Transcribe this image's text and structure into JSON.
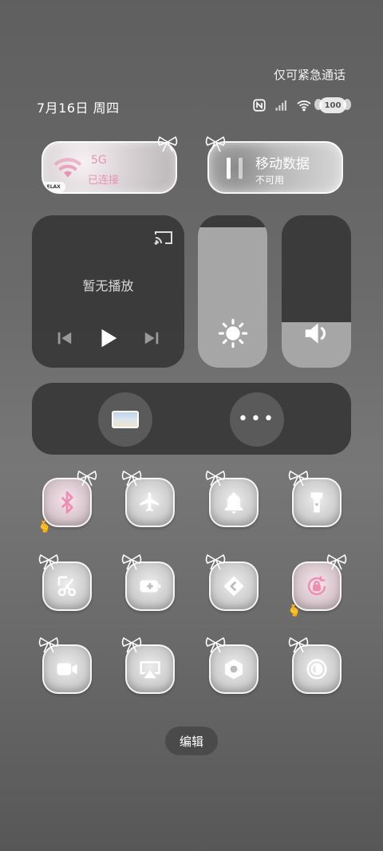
{
  "status_bar": {
    "emergency_text": "仅可紧急通话",
    "date_text": "7月16日 周四",
    "battery_level": "100",
    "icons": [
      "nfc-icon",
      "signal-icon",
      "wifi-status-icon",
      "battery-icon"
    ]
  },
  "wifi_tile": {
    "ssid": "5G",
    "status": "已连接",
    "tag": "RELAX"
  },
  "data_tile": {
    "title": "移动数据",
    "status": "不可用"
  },
  "media": {
    "status": "暂无播放"
  },
  "brightness": {
    "level": 0.92
  },
  "volume": {
    "level": 0.3
  },
  "app_strip": {
    "more_symbol": "•••"
  },
  "toggles": [
    {
      "name": "bluetooth",
      "active": true
    },
    {
      "name": "airplane",
      "active": false
    },
    {
      "name": "do-not-disturb",
      "active": false
    },
    {
      "name": "flashlight",
      "active": false
    },
    {
      "name": "screenshot",
      "active": false
    },
    {
      "name": "battery-saver",
      "active": false
    },
    {
      "name": "nearby-share",
      "active": false
    },
    {
      "name": "rotation-lock",
      "active": true
    },
    {
      "name": "screen-record",
      "active": false
    },
    {
      "name": "screen-cast",
      "active": false
    },
    {
      "name": "settings",
      "active": false
    },
    {
      "name": "dark-mode",
      "active": false
    }
  ],
  "edit_label": "编辑",
  "colors": {
    "accent_pink": "#ee8fb2",
    "panel": "#373737",
    "fill": "#a6a6a6"
  }
}
